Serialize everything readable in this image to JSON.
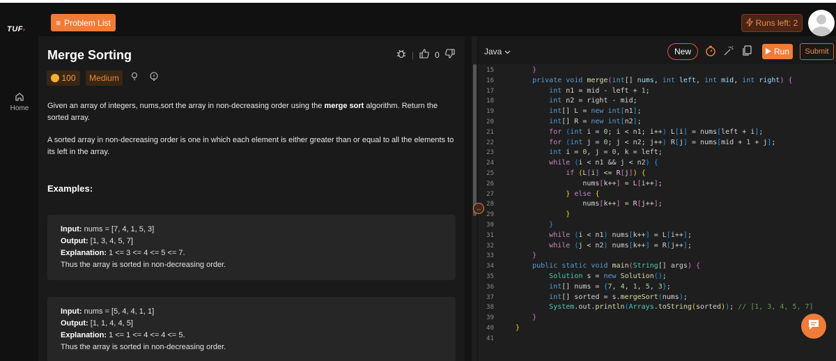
{
  "brand": {
    "logo": "TUF",
    "accent": "#f07c38"
  },
  "header": {
    "problem_list_label": "Problem List",
    "runs_left_label": "Runs left: 2"
  },
  "sidebar": {
    "items": [
      {
        "label": "Home",
        "icon": "home-icon"
      }
    ]
  },
  "problem": {
    "title": "Merge Sorting",
    "likes": "0",
    "coins": "100",
    "difficulty": "Medium",
    "desc1_pre": "Given an array of integers, nums,sort the array in non-decreasing order using the ",
    "desc1_bold": "merge sort",
    "desc1_post": " algorithm. Return the sorted array.",
    "desc2": "A sorted array in non-decreasing order is one in which each element is either greater than or equal to all the elements to its left in the array.",
    "examples_heading": "Examples:",
    "examples": [
      {
        "input_label": "Input:",
        "input": " nums = [7, 4, 1, 5, 3]",
        "output_label": "Output:",
        "output": " [1, 3, 4, 5, 7]",
        "explanation_label": "Explanation:",
        "explanation": " 1 <= 3 <= 4 <= 5 <= 7.",
        "note": "Thus the array is sorted in non-decreasing order."
      },
      {
        "input_label": "Input:",
        "input": " nums = [5, 4, 4, 1, 1]",
        "output_label": "Output:",
        "output": " [1, 1, 4, 4, 5]",
        "explanation_label": "Explanation:",
        "explanation": " 1 <= 1 <= 4 <= 4 <= 5.",
        "note": "Thus the array is sorted in non-decreasing order."
      }
    ]
  },
  "editor": {
    "language": "Java",
    "new_label": "New",
    "run_label": "Run",
    "submit_label": "Submit",
    "line_numbers": [
      "15",
      "16",
      "17",
      "18",
      "19",
      "20",
      "21",
      "22",
      "23",
      "24",
      "25",
      "26",
      "27",
      "28",
      "29",
      "30",
      "31",
      "32",
      "33",
      "34",
      "35",
      "36",
      "37",
      "38",
      "39",
      "40",
      "41"
    ]
  }
}
